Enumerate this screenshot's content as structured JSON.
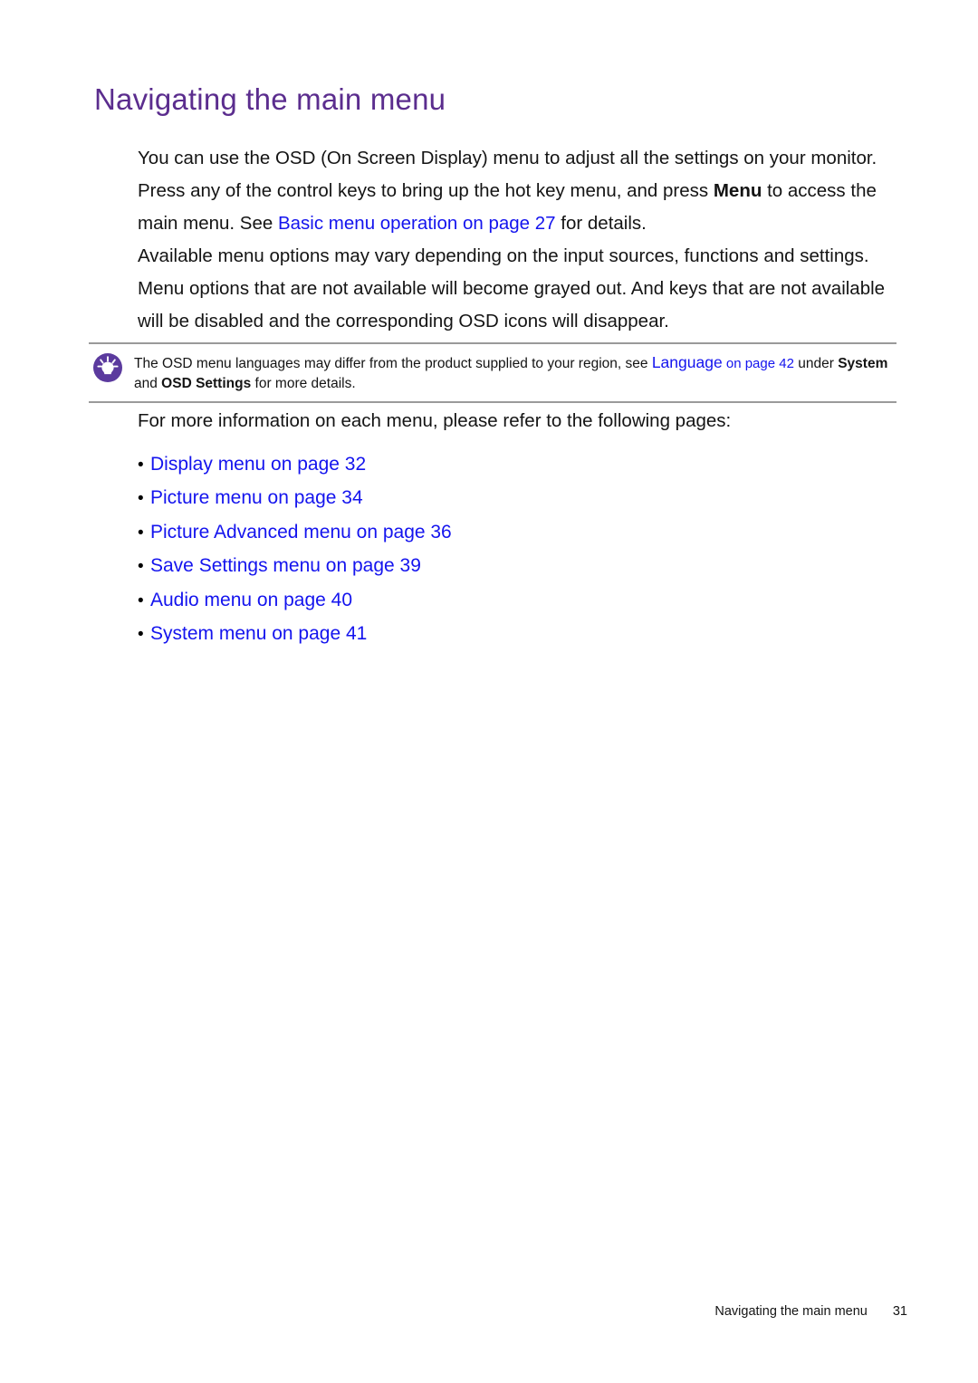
{
  "document": {
    "title": "Navigating the main menu"
  },
  "paragraphs": {
    "intro": {
      "part1": "You can use the OSD (On Screen Display) menu to adjust all the settings on your monitor. Press any of the control keys to bring up the hot key menu, and press ",
      "bold1": "Menu",
      "part2": " to access the main menu. See ",
      "link1": "Basic menu operation on page 27",
      "part3": " for details."
    },
    "available": {
      "text": "Available menu options may vary depending on the input sources, functions and settings. Menu options that are not available will become grayed out. And keys that are not available will be disabled and the corresponding OSD icons will disappear."
    },
    "more_info": {
      "text": "For more information on each menu, please refer to the following pages:"
    }
  },
  "note": {
    "icon": "lightbulb-icon",
    "icon_color": "#5b3a9e",
    "part1": "The OSD menu languages may differ from the product supplied to your region, see ",
    "link_main": "Language",
    "link_sub": " on page 42",
    "part2": " under ",
    "bold1": "System",
    "part3": " and ",
    "bold2": "OSD Settings",
    "part4": " for more details."
  },
  "bullets": [
    {
      "bullet": "•",
      "label": "Display menu on page 32"
    },
    {
      "bullet": "•",
      "label": "Picture menu on page 34"
    },
    {
      "bullet": "•",
      "label": "Picture Advanced menu on page 36"
    },
    {
      "bullet": "•",
      "label": "Save Settings menu on page 39"
    },
    {
      "bullet": "•",
      "label": "Audio menu on page 40"
    },
    {
      "bullet": "•",
      "label": "System menu on page 41"
    }
  ],
  "footer": {
    "chapter": "Navigating the main menu",
    "page_number": "31"
  },
  "colors": {
    "title_purple": "#5b2d8e",
    "link_blue": "#1414ee",
    "rule_gray": "#9a9a9a",
    "text_black": "#141414"
  }
}
